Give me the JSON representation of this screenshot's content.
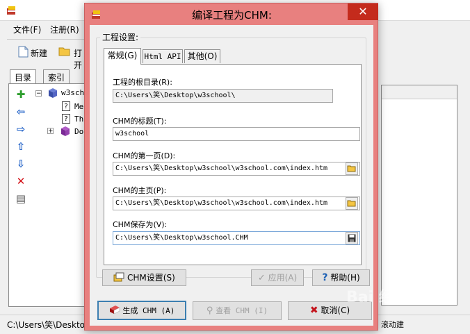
{
  "app": {
    "menus": [
      "文件(F)",
      "注册(R)"
    ],
    "toolbar": {
      "new_label": "新建",
      "open_label": "打开"
    },
    "left_tabs": [
      "目录",
      "索引"
    ],
    "tree": {
      "root": "w3scho",
      "items": [
        "Me",
        "Th",
        "Do"
      ]
    },
    "status_text": "C:\\Users\\笑\\Deskto",
    "status_right": "滚动建"
  },
  "dialog": {
    "title": "编译工程为CHM:",
    "close_glyph": "✕",
    "group_label": "工程设置:",
    "tabs": [
      "常规(G)",
      "Html API",
      "其他(O)"
    ],
    "fields": {
      "root_dir": {
        "label": "工程的根目录(R):",
        "value": "C:\\Users\\笑\\Desktop\\w3school\\"
      },
      "title": {
        "label": "CHM的标题(T):",
        "value": "w3school"
      },
      "first_page": {
        "label": "CHM的第一页(D):",
        "value": "C:\\Users\\笑\\Desktop\\w3school\\w3school.com\\index.htm"
      },
      "home_page": {
        "label": "CHM的主页(P):",
        "value": "C:\\Users\\笑\\Desktop\\w3school\\w3school.com\\index.htm"
      },
      "save_as": {
        "label": "CHM保存为(V):",
        "value": "C:\\Users\\笑\\Desktop\\w3school.CHM"
      }
    },
    "buttons": {
      "chm_settings": "CHM设置(S)",
      "apply": "应用(A)",
      "help": "帮助(H)",
      "build": "生成 CHM (A)",
      "view": "查看 CHM (I)",
      "cancel": "取消(C)"
    }
  },
  "watermark": "Bai 经验"
}
